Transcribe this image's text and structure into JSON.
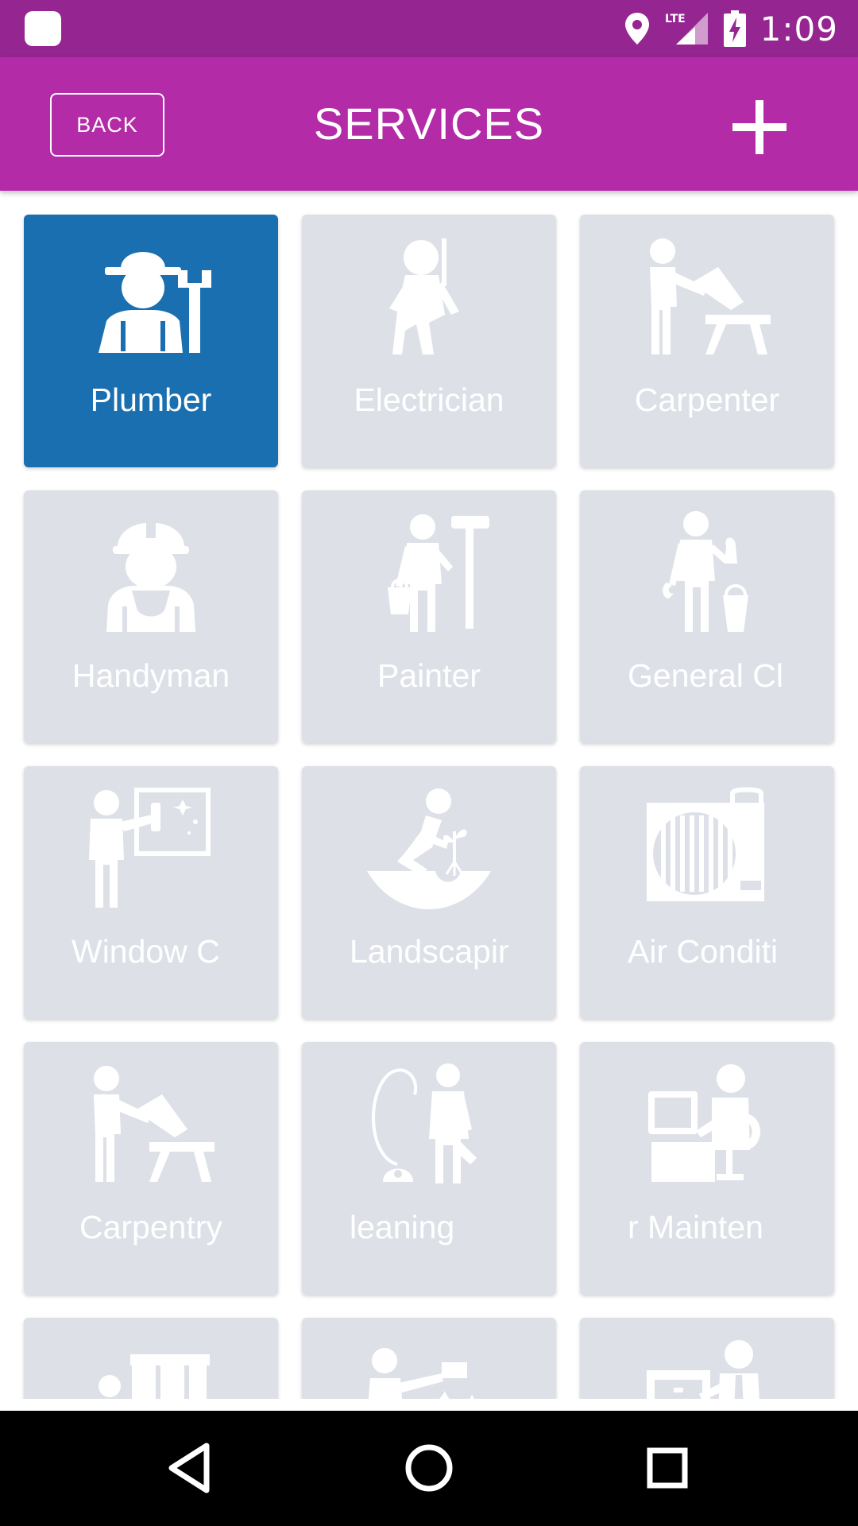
{
  "status_bar": {
    "time": "1:09",
    "network": "LTE",
    "icons": [
      "app-notification-icon",
      "location-pin-icon",
      "lte-signal-icon",
      "battery-charging-icon"
    ]
  },
  "header": {
    "back_label": "BACK",
    "title": "SERVICES",
    "add_icon": "plus-icon"
  },
  "colors": {
    "status_bar": "#952590",
    "app_bar": "#b42ba8",
    "tile_selected": "#1a6fb0",
    "tile_default": "#dde1e7"
  },
  "services": [
    {
      "label": "Plumber",
      "icon": "plumber-icon",
      "selected": true
    },
    {
      "label": "Electrician",
      "icon": "electrician-icon",
      "selected": false
    },
    {
      "label": "Carpenter",
      "icon": "carpenter-icon",
      "selected": false
    },
    {
      "label": "Handyman",
      "icon": "handyman-icon",
      "selected": false
    },
    {
      "label": "Painter",
      "icon": "painter-icon",
      "selected": false
    },
    {
      "label": "General Cl",
      "icon": "general-cleaning-icon",
      "selected": false
    },
    {
      "label": "Window C",
      "icon": "window-cleaning-icon",
      "selected": false
    },
    {
      "label": "Landscapin",
      "icon": "landscaping-icon",
      "selected": false
    },
    {
      "label": "Air Conditi",
      "icon": "air-conditioning-icon",
      "selected": false
    },
    {
      "label": "Carpentry",
      "icon": "carpentry-icon",
      "selected": false
    },
    {
      "label": "leaning",
      "icon": "vacuum-cleaning-icon",
      "selected": false
    },
    {
      "label": "r Mainten",
      "icon": "computer-maintenance-icon",
      "selected": false
    },
    {
      "label": "",
      "icon": "heater-repair-icon",
      "selected": false
    },
    {
      "label": "",
      "icon": "pest-control-icon",
      "selected": false
    },
    {
      "label": "",
      "icon": "office-furniture-icon",
      "selected": false
    }
  ],
  "nav_bar": {
    "icons": [
      "back-triangle-icon",
      "home-circle-icon",
      "recents-square-icon"
    ]
  }
}
